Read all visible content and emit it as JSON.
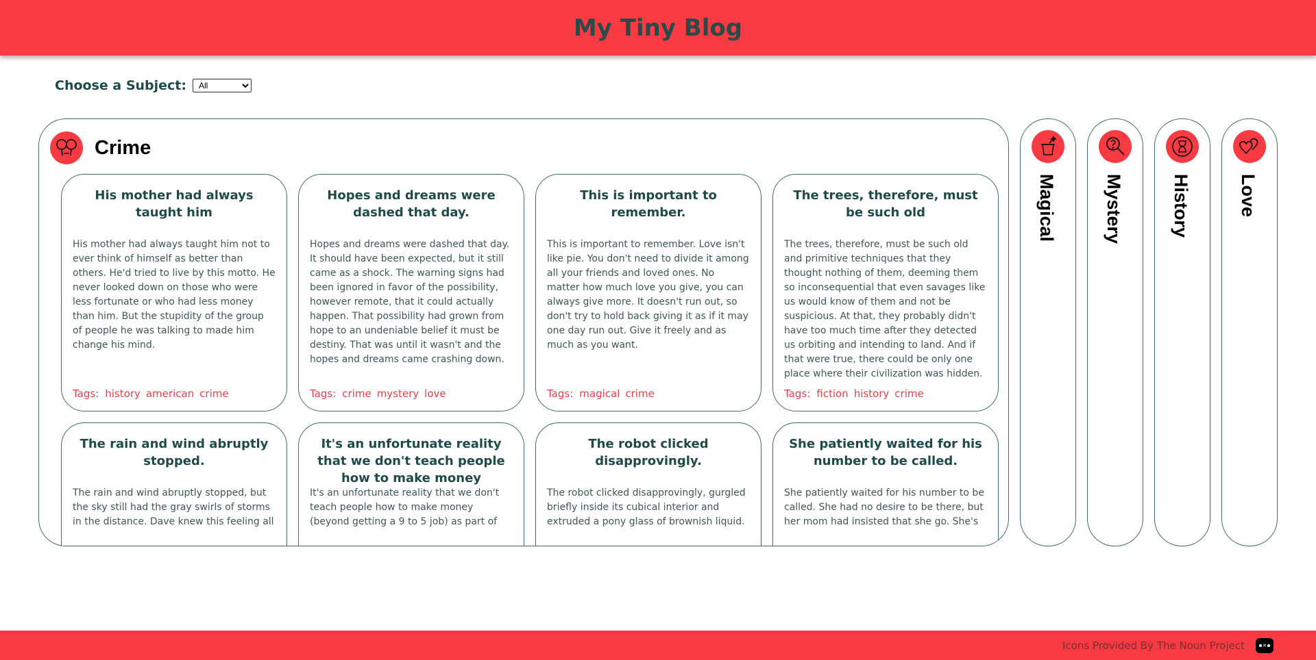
{
  "header": {
    "title": "My Tiny Blog"
  },
  "filter": {
    "label": "Choose a Subject:",
    "selected": "All"
  },
  "main_panel": {
    "title": "Crime",
    "icon": "handcuffs-icon",
    "tags_label": "Tags:",
    "cards": [
      {
        "title": "His mother had always taught him",
        "text": "His mother had always taught him not to ever think of himself as better than others. He'd tried to live by this motto. He never looked down on those who were less fortunate or who had less money than him. But the stupidity of the group of people he was talking to made him change his mind.",
        "tags": [
          "history",
          "american",
          "crime"
        ]
      },
      {
        "title": "Hopes and dreams were dashed that day.",
        "text": "Hopes and dreams were dashed that day. It should have been expected, but it still came as a shock. The warning signs had been ignored in favor of the possibility, however remote, that it could actually happen. That possibility had grown from hope to an undeniable belief it must be destiny. That was until it wasn't and the hopes and dreams came crashing down.",
        "tags": [
          "crime",
          "mystery",
          "love"
        ]
      },
      {
        "title": "This is important to remember.",
        "text": "This is important to remember. Love isn't like pie. You don't need to divide it among all your friends and loved ones. No matter how much love you give, you can always give more. It doesn't run out, so don't try to hold back giving it as if it may one day run out. Give it freely and as much as you want.",
        "tags": [
          "magical",
          "crime"
        ]
      },
      {
        "title": "The trees, therefore, must be such old",
        "text": "The trees, therefore, must be such old and primitive techniques that they thought nothing of them, deeming them so inconsequential that even savages like us would know of them and not be suspicious. At that, they probably didn't have too much time after they detected us orbiting and intending to land. And if that were true, there could be only one place where their civilization was hidden.",
        "tags": [
          "fiction",
          "history",
          "crime"
        ]
      },
      {
        "title": "The rain and wind abruptly stopped.",
        "text": "The rain and wind abruptly stopped, but the sky still had the gray swirls of storms in the distance. Dave knew this feeling all",
        "tags": []
      },
      {
        "title": "It's an unfortunate reality that we don't teach people how to make money",
        "text": "It's an unfortunate reality that we don't teach people how to make money (beyond getting a 9 to 5 job) as part of",
        "tags": []
      },
      {
        "title": "The robot clicked disapprovingly.",
        "text": "The robot clicked disapprovingly, gurgled briefly inside its cubical interior and extruded a pony glass of brownish liquid.",
        "tags": []
      },
      {
        "title": "She patiently waited for his number to be called.",
        "text": "She patiently waited for his number to be called. She had no desire to be there, but her mom had insisted that she go. She's",
        "tags": []
      }
    ]
  },
  "side_tabs": [
    {
      "label": "Magical",
      "icon": "magic-hat-icon"
    },
    {
      "label": "Mystery",
      "icon": "magnifier-question-icon"
    },
    {
      "label": "History",
      "icon": "hourglass-icon"
    },
    {
      "label": "Love",
      "icon": "hearts-icon"
    }
  ],
  "footer": {
    "credit": "Icons Provided By The Noun Project",
    "logo_icon": "noun-project-logo-icon"
  },
  "colors": {
    "accent": "#f83a43",
    "text": "#1f4a4a",
    "tag": "#e8404a",
    "border": "#3f6b6b"
  }
}
